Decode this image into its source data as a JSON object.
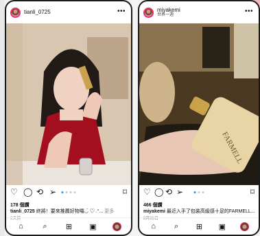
{
  "left": {
    "username": "tianli_0725",
    "likes": "178 個讚",
    "caption_user": "tianli_0725",
    "caption_text": "終將！要來推薦好物囉◡̈ ♡ .°...",
    "caption_more": "更多",
    "date": "2天前"
  },
  "right": {
    "username": "miyakemi",
    "subtitle": "世界一週",
    "likes": "466 個讚",
    "caption_user": "miyakemi",
    "caption_text": "最近入手了包裝高級感十足的FARMELL...",
    "caption_more": "更多",
    "date": "8月26日",
    "bottle_text": "FARMELL"
  },
  "icons": {
    "more": "more-icon",
    "heart": "heart-icon",
    "comment": "comment-icon",
    "repost": "repost-icon",
    "share": "share-icon",
    "bookmark": "bookmark-icon",
    "home": "home-icon",
    "search": "search-icon",
    "create": "create-icon",
    "reels": "reels-icon",
    "profile": "profile-avatar"
  },
  "colors": {
    "accent": "#1d9bf0",
    "story_ring": "#e1306c"
  }
}
